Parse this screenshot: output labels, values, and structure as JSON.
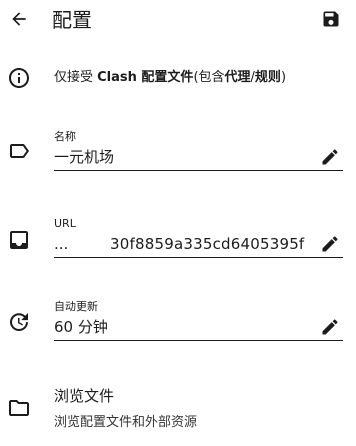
{
  "appbar": {
    "title": "配置",
    "back_icon": "arrow-back-icon",
    "save_icon": "save-icon"
  },
  "info": {
    "icon": "info-icon",
    "text_prefix": "仅接受 ",
    "text_bold1": "Clash 配置文件",
    "text_mid": "(包含",
    "text_bold2": "代理",
    "text_slash": "/",
    "text_bold3": "规则",
    "text_suffix": ")"
  },
  "name_field": {
    "icon": "label-tag-icon",
    "label": "名称",
    "value": "一元机场"
  },
  "url_field": {
    "icon": "inbox-tray-icon",
    "label": "URL",
    "value_prefix": "...",
    "value_tail": "30f8859a335cd6405395f"
  },
  "update_field": {
    "icon": "update-clock-icon",
    "label": "自动更新",
    "value": "60 分钟"
  },
  "browse": {
    "icon": "folder-icon",
    "title": "浏览文件",
    "subtitle": "浏览配置文件和外部资源"
  },
  "colors": {
    "text": "#1c1c1c",
    "background": "#ffffff"
  }
}
